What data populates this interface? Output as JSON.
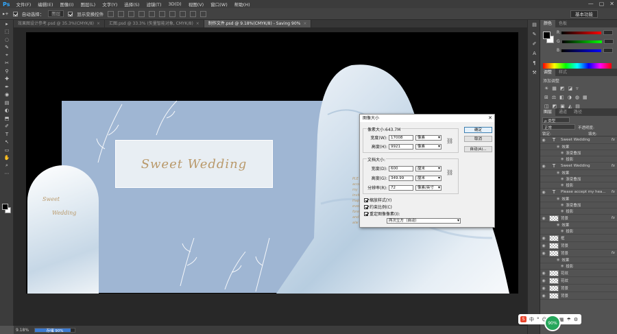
{
  "app": {
    "logo": "Ps"
  },
  "menu": [
    "文件(F)",
    "编辑(E)",
    "图像(I)",
    "图层(L)",
    "文字(Y)",
    "选择(S)",
    "滤镜(T)",
    "3D(D)",
    "视图(V)",
    "窗口(W)",
    "帮助(H)"
  ],
  "window_controls": [
    "—",
    "▢",
    "✕"
  ],
  "options": {
    "auto_select_label": "自动选择：",
    "auto_select_value": "图层",
    "show_transform_label": "显示变换控件",
    "workspace": "基本功能"
  },
  "tabs": [
    {
      "label": "效果图设计参考.psd @ 35.3%(CMYK/8)",
      "close": "×"
    },
    {
      "label": "汇图.psd @ 33.3% (矢量智能对象, CMYK/8)",
      "close": "×"
    },
    {
      "label": "制作文件.psd @ 9.18%(CMYK/8) - Saving 90%",
      "close": "×"
    }
  ],
  "tools": [
    "▸",
    "⬚",
    "◌",
    "✎",
    "⌖",
    "✂",
    "⚲",
    "✚",
    "✒",
    "◉",
    "▤",
    "◐",
    "⬒",
    "✐",
    "T",
    "↖",
    "▭",
    "✋",
    "⌕",
    "⋯"
  ],
  "canvas": {
    "title": "Sweet  Wedding",
    "arch_line1": "Sweet",
    "arch_line2": "Wedding",
    "side_text": [
      "PLE",
      "acce",
      "my",
      "invit",
      "Hap",
      "every",
      "fore",
      "and",
      "alw"
    ]
  },
  "status": {
    "zoom": "9.18%",
    "progress_label": "存储 90%",
    "progress": 0.9
  },
  "dialog": {
    "title": "图像大小",
    "close": "✕",
    "pixel_group": "像素大小:643.7M",
    "width_label": "宽度(W):",
    "width_value": "17008",
    "width_unit": "像素",
    "height_label": "高度(H):",
    "height_value": "9921",
    "height_unit": "像素",
    "doc_group": "文档大小:",
    "doc_width_label": "宽度(D):",
    "doc_width_value": "600",
    "doc_width_unit": "厘米",
    "doc_height_label": "高度(G):",
    "doc_height_value": "349.99",
    "doc_height_unit": "厘米",
    "res_label": "分辨率(R):",
    "res_value": "72",
    "res_unit": "像素/英寸",
    "scale_styles": "缩放样式(Y)",
    "constrain": "约束比例(C)",
    "resample": "重定图像像素(I):",
    "resample_method": "两次立方（自动）",
    "ok": "确定",
    "cancel": "取消",
    "auto": "自动(A)..."
  },
  "right_panel": {
    "color_tabs": [
      "颜色",
      "色板"
    ],
    "rgb": [
      "R",
      "G",
      "B"
    ],
    "adj_tabs": [
      "调整",
      "样式"
    ],
    "adj_label": "添加调整",
    "adj_row1": [
      "☀",
      "▦",
      "◩",
      "◪",
      "▿"
    ],
    "adj_row2": [
      "⊞",
      "⚖",
      "◧",
      "◑",
      "◍",
      "▦"
    ],
    "adj_row3": [
      "◫",
      "◩",
      "▣",
      "◭",
      "▤"
    ],
    "layer_tabs": [
      "图层",
      "通道",
      "路径"
    ],
    "kind_label": "ρ 类型",
    "blend_mode": "正常",
    "opacity_label": "不透明度:",
    "lock_label": "锁定:",
    "fill_label": "填充:",
    "layers": [
      {
        "kind": "text",
        "name": "Sweet  Wedding",
        "fx": "fx"
      },
      {
        "kind": "sub",
        "name": "效果"
      },
      {
        "kind": "sub2",
        "name": "渐变叠加"
      },
      {
        "kind": "sub2",
        "name": "投影"
      },
      {
        "kind": "text",
        "name": "Sweet  Wedding",
        "fx": "fx"
      },
      {
        "kind": "sub",
        "name": "效果"
      },
      {
        "kind": "sub2",
        "name": "渐变叠加"
      },
      {
        "kind": "sub2",
        "name": "投影"
      },
      {
        "kind": "text",
        "name": "Please accept my hea...",
        "fx": "fx"
      },
      {
        "kind": "sub",
        "name": "效果"
      },
      {
        "kind": "sub2",
        "name": "渐变叠加"
      },
      {
        "kind": "sub2",
        "name": "投影"
      },
      {
        "kind": "image",
        "name": "背景",
        "fx": "fx"
      },
      {
        "kind": "sub",
        "name": "效果"
      },
      {
        "kind": "sub2",
        "name": "投影"
      },
      {
        "kind": "image",
        "name": "框"
      },
      {
        "kind": "image",
        "name": "背景"
      },
      {
        "kind": "image",
        "name": "背景",
        "fx": "fx"
      },
      {
        "kind": "sub",
        "name": "效果"
      },
      {
        "kind": "sub2",
        "name": "投影"
      },
      {
        "kind": "image",
        "name": "花纹"
      },
      {
        "kind": "image",
        "name": "花纹"
      },
      {
        "kind": "image",
        "name": "背景"
      },
      {
        "kind": "image",
        "name": "背景"
      }
    ]
  },
  "widget": {
    "items": [
      "S",
      "中",
      "°",
      "☺",
      "⌨",
      "▦",
      "☂",
      "⚙"
    ],
    "badge": "90%"
  }
}
